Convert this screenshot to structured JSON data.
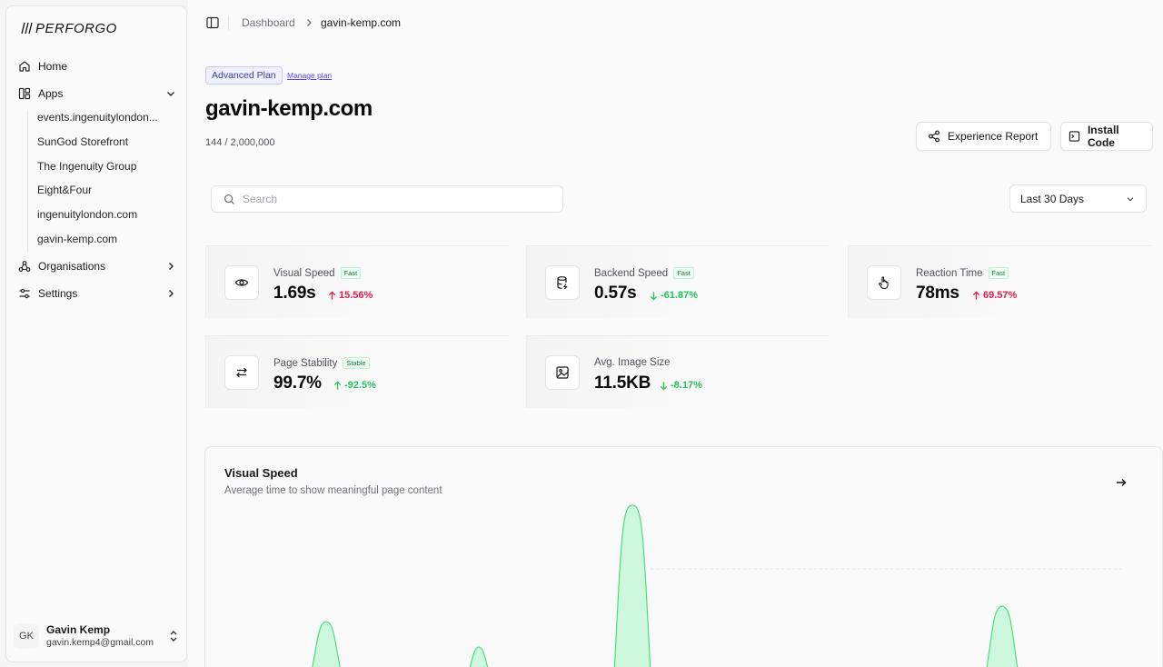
{
  "app": {
    "brand": "PERFORGO"
  },
  "sidebar": {
    "items": [
      {
        "label": "Home",
        "icon": "home-icon"
      },
      {
        "label": "Apps",
        "icon": "apps-icon",
        "expanded": true
      },
      {
        "label": "Organisations",
        "icon": "organisations-icon"
      },
      {
        "label": "Settings",
        "icon": "settings-icon"
      }
    ],
    "apps": [
      "events.ingenuitylondon...",
      "SunGod Storefront",
      "The Ingenuity Group",
      "Eight&Four",
      "ingenuitylondon.com",
      "gavin-kemp.com"
    ],
    "user": {
      "initials": "GK",
      "name": "Gavin Kemp",
      "email": "gavin.kemp4@gmail.com"
    }
  },
  "breadcrumb": {
    "parent": "Dashboard",
    "current": "gavin-kemp.com"
  },
  "header": {
    "plan_badge": "Advanced Plan",
    "manage_plan": "Manage plan",
    "title": "gavin-kemp.com",
    "quota": "144 / 2,000,000",
    "experience_report": "Experience Report",
    "install_code": "Install Code"
  },
  "search": {
    "placeholder": "Search",
    "value": ""
  },
  "range": {
    "selected": "Last 30 Days"
  },
  "metrics": [
    {
      "label": "Visual Speed",
      "badge": "Fast",
      "value": "1.69s",
      "change": "15.56%",
      "direction": "up",
      "icon": "eye-icon"
    },
    {
      "label": "Backend Speed",
      "badge": "Fast",
      "value": "0.57s",
      "change": "-61.87%",
      "direction": "down",
      "icon": "database-icon"
    },
    {
      "label": "Reaction Time",
      "badge": "Fast",
      "value": "78ms",
      "change": "69.57%",
      "direction": "up",
      "icon": "pointer-hand-icon"
    },
    {
      "label": "Page Stability",
      "badge": "Stable",
      "value": "99.7%",
      "change": "-92.5%",
      "direction": "up",
      "icon": "arrows-left-right-icon"
    },
    {
      "label": "Avg. Image Size",
      "badge": "",
      "value": "11.5KB",
      "change": "-8.17%",
      "direction": "down",
      "icon": "image-icon"
    }
  ],
  "chart_card": {
    "title": "Visual Speed",
    "subtitle": "Average time to show meaningful page content"
  },
  "colors": {
    "accent": "#4f46e5",
    "bad": "#e11d48",
    "good": "#22c55e",
    "chart_fill": "#bbf7d0",
    "chart_stroke": "#4ade80"
  },
  "chart_data": {
    "type": "area",
    "peak_heights": [
      0.27,
      0.14,
      0.87,
      0.35
    ],
    "grid": true
  }
}
